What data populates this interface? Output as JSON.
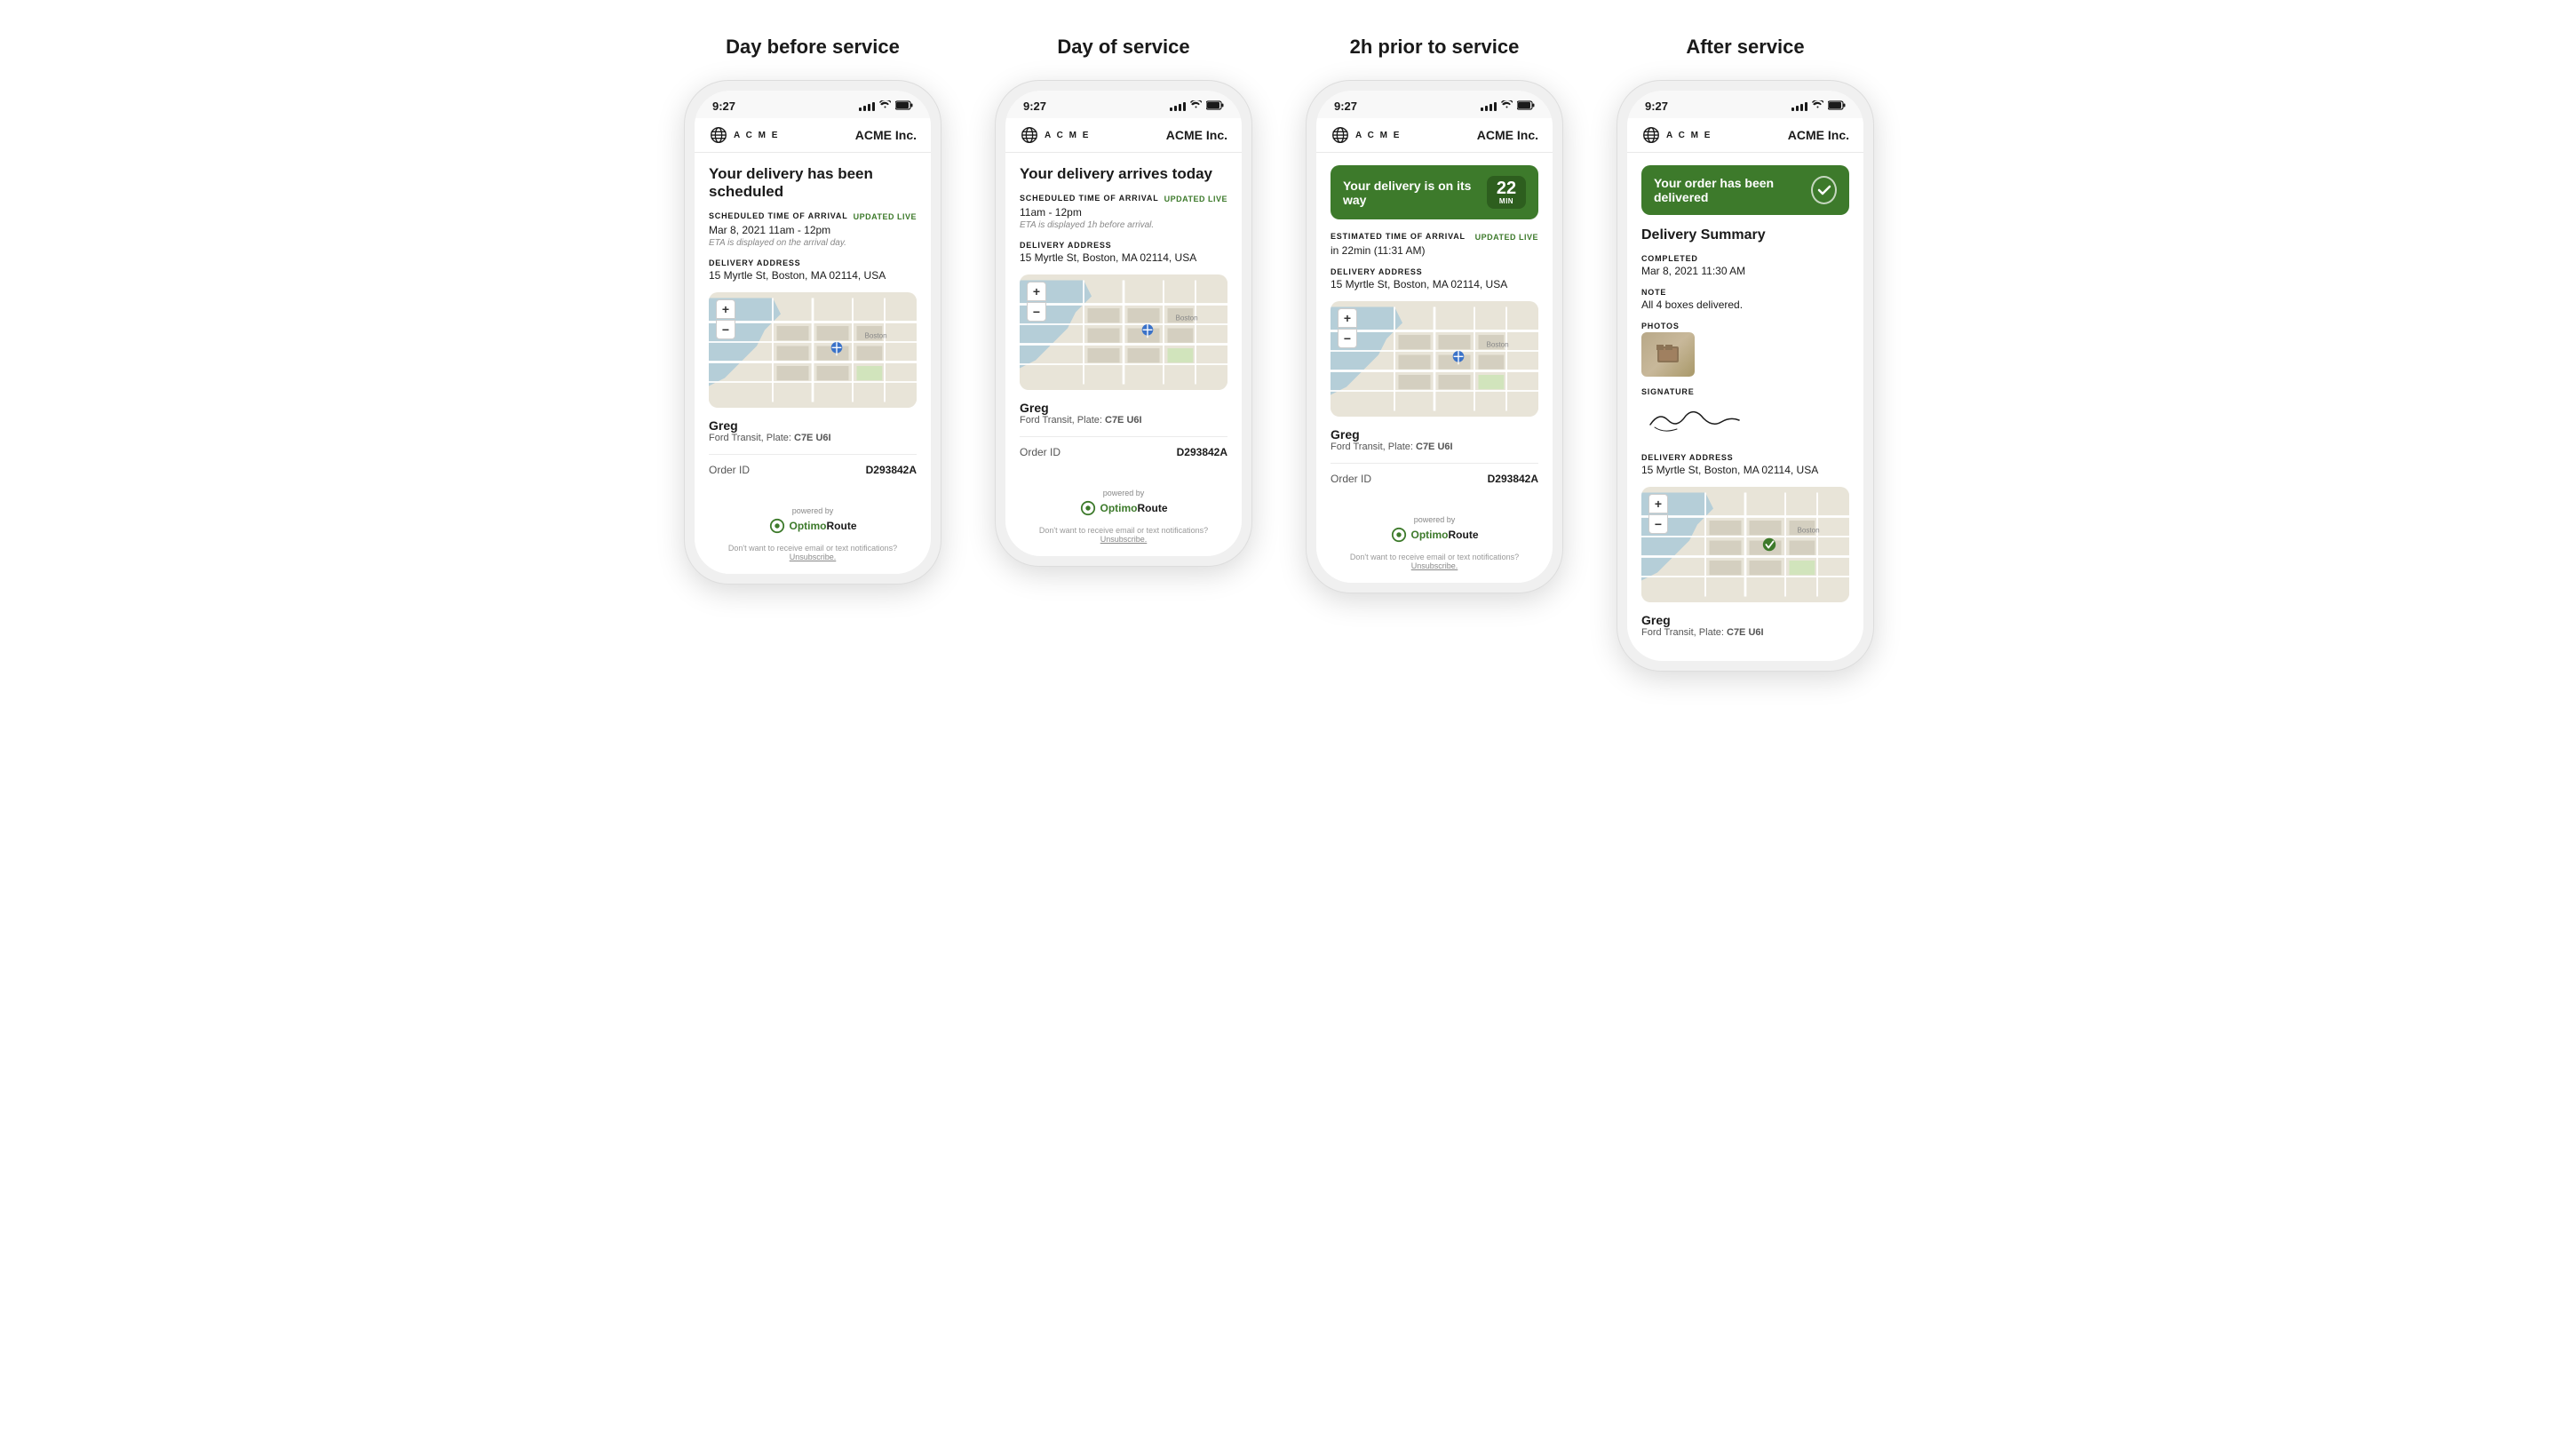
{
  "page": {
    "background": "#ffffff"
  },
  "columns": [
    {
      "id": "day-before",
      "title": "Day before service",
      "phone": {
        "status_bar": {
          "time": "9:27"
        },
        "header": {
          "brand": "A C M E",
          "company": "ACME Inc."
        },
        "banner": {
          "type": "title-only",
          "text": "Your delivery has been scheduled"
        },
        "sections": [
          {
            "label": "Scheduled time of arrival",
            "label_extra": "UPDATED LIVE",
            "value": "Mar 8, 2021  11am - 12pm",
            "note": "ETA is displayed on the arrival day."
          },
          {
            "label": "Delivery address",
            "value": "15 Myrtle St, Boston, MA 02114, USA",
            "note": ""
          }
        ],
        "driver": {
          "name": "Greg",
          "vehicle": "Ford Transit, Plate:",
          "plate": "C7E U6I"
        },
        "order_id": "D293842A",
        "footer": {
          "powered_by": "powered by",
          "logo_text": "OptimoRoute",
          "unsub_text": "Don't want to receive email or text notifications?",
          "unsub_link": "Unsubscribe."
        }
      }
    },
    {
      "id": "day-of",
      "title": "Day of service",
      "phone": {
        "status_bar": {
          "time": "9:27"
        },
        "header": {
          "brand": "A C M E",
          "company": "ACME Inc."
        },
        "banner": {
          "type": "title-only",
          "text": "Your delivery arrives today"
        },
        "sections": [
          {
            "label": "Scheduled time of arrival",
            "label_extra": "UPDATED LIVE",
            "value": "11am - 12pm",
            "note": "ETA is displayed 1h before arrival."
          },
          {
            "label": "Delivery address",
            "value": "15 Myrtle St, Boston, MA 02114, USA",
            "note": ""
          }
        ],
        "driver": {
          "name": "Greg",
          "vehicle": "Ford Transit, Plate:",
          "plate": "C7E U6I"
        },
        "order_id": "D293842A",
        "footer": {
          "powered_by": "powered by",
          "logo_text": "OptimoRoute",
          "unsub_text": "Don't want to receive email or text notifications?",
          "unsub_link": "Unsubscribe."
        }
      }
    },
    {
      "id": "2h-prior",
      "title": "2h prior to service",
      "phone": {
        "status_bar": {
          "time": "9:27"
        },
        "header": {
          "brand": "A C M E",
          "company": "ACME Inc."
        },
        "banner": {
          "type": "in-transit",
          "text": "Your delivery is on its way",
          "badge_number": "22",
          "badge_label": "MIN"
        },
        "sections": [
          {
            "label": "Estimated time of arrival",
            "label_extra": "UPDATED LIVE",
            "value": "in 22min (11:31 AM)",
            "note": ""
          },
          {
            "label": "Delivery address",
            "value": "15 Myrtle St, Boston, MA 02114, USA",
            "note": ""
          }
        ],
        "driver": {
          "name": "Greg",
          "vehicle": "Ford Transit, Plate:",
          "plate": "C7E U6I"
        },
        "order_id": "D293842A",
        "footer": {
          "powered_by": "powered by",
          "logo_text": "OptimoRoute",
          "unsub_text": "Don't want to receive email or text notifications?",
          "unsub_link": "Unsubscribe."
        }
      }
    },
    {
      "id": "after",
      "title": "After service",
      "phone": {
        "status_bar": {
          "time": "9:27"
        },
        "header": {
          "brand": "A C M E",
          "company": "ACME Inc."
        },
        "banner": {
          "type": "delivered",
          "text": "Your order has been delivered"
        },
        "summary": {
          "title": "Delivery Summary",
          "completed_label": "COMPLETED",
          "completed_value": "Mar 8, 2021 11:30 AM",
          "note_label": "NOTE",
          "note_value": "All 4 boxes delivered.",
          "photos_label": "PHOTOS",
          "signature_label": "SIGNATURE",
          "address_label": "DELIVERY ADDRESS",
          "address_value": "15 Myrtle St, Boston, MA 02114, USA"
        },
        "driver": {
          "name": "Greg",
          "vehicle": "Ford Transit, Plate:",
          "plate": "C7E U6I"
        }
      }
    }
  ]
}
